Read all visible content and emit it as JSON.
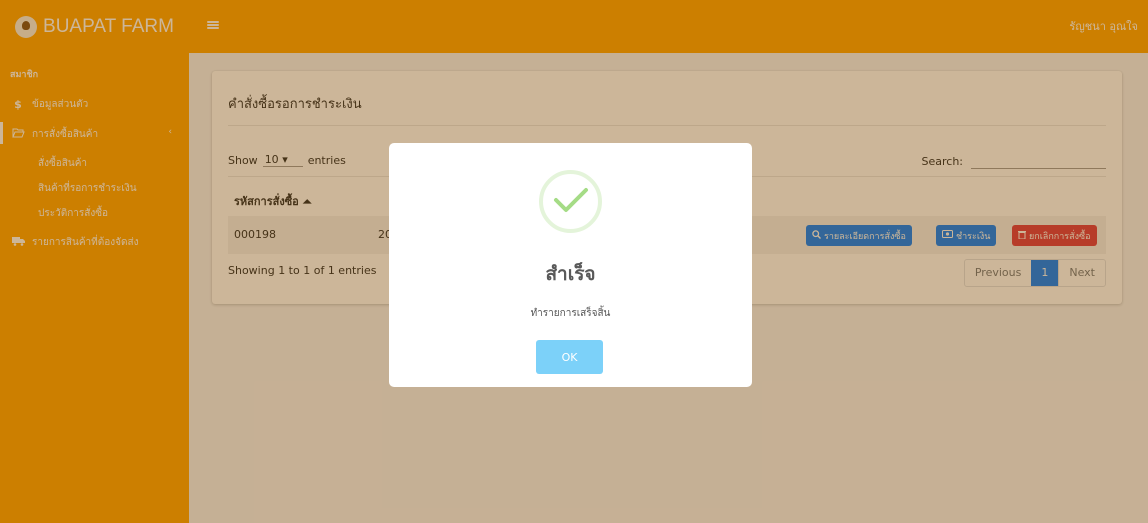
{
  "header": {
    "brand": "BUAPAT FARM",
    "user_name": "รัญชนา อุณใจ"
  },
  "sidebar": {
    "section_label": "สมาชิก",
    "items": [
      {
        "icon": "dollar-icon",
        "label": "ข้อมูลส่วนตัว"
      },
      {
        "icon": "folder-open-icon",
        "label": "การสั่งซื้อสินค้า"
      },
      {
        "icon": "truck-icon",
        "label": "รายการสินค้าที่ต้องจัดส่ง"
      }
    ],
    "sub_items": [
      "สั่งซื้อสินค้า",
      "สินค้าที่รอการชำระเงิน",
      "ประวัติการสั่งซื้อ"
    ]
  },
  "main": {
    "card_title": "คำสั่งซื้อรอการชำระเงิน",
    "show_label": "Show",
    "entries_value": "10",
    "entries_label": "entries",
    "search_label": "Search:",
    "column_header": "รหัสการสั่งซื้อ",
    "rows": [
      {
        "order_id": "000198",
        "date_fragment": "20"
      }
    ],
    "buttons": {
      "details": "รายละเอียดการสั่งซื้อ",
      "pay": "ชำระเงิน",
      "cancel": "ยกเลิกการสั่งซื้อ"
    },
    "info": "Showing 1 to 1 of 1 entries",
    "pagination": {
      "previous": "Previous",
      "current": "1",
      "next": "Next"
    }
  },
  "modal": {
    "icon": "success-check-icon",
    "title": "สำเร็จ",
    "text": "ทำรายการเสร็จสิ้น",
    "ok_label": "OK"
  },
  "colors": {
    "header": "#ffa300",
    "primary": "#007bff",
    "danger": "#dc3545",
    "ok": "#7cd1f9",
    "success": "#a5dc86"
  }
}
